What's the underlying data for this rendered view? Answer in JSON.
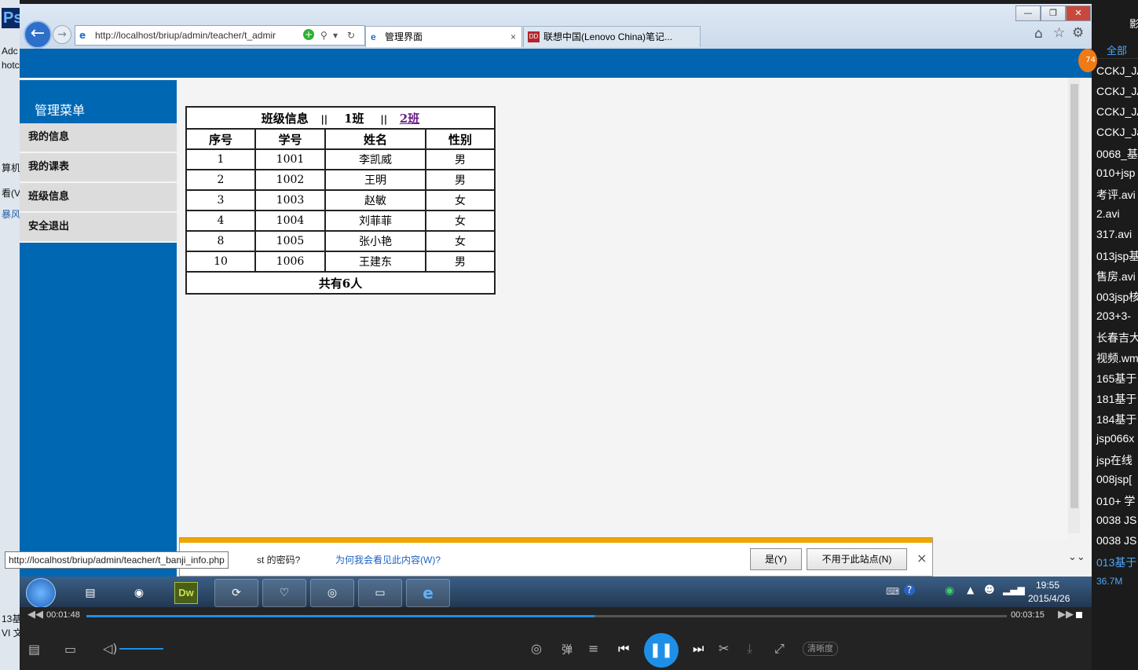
{
  "left_strip": {
    "app_badge": "Ps",
    "labels": [
      "Adc",
      "hotc",
      "算机",
      "看(V",
      "暴风",
      "13基",
      "VI 文"
    ]
  },
  "browser": {
    "address_url": "http://localhost/briup/admin/teacher/t_admir",
    "tabs": [
      {
        "label": "管理界面",
        "close": "×"
      },
      {
        "label": "联想中国(Lenovo China)笔记..."
      }
    ],
    "window_controls": [
      "—",
      "❐",
      "✕"
    ]
  },
  "sidebar": {
    "title": "管理菜单",
    "items": [
      "我的信息",
      "我的课表",
      "班级信息",
      "安全退出"
    ]
  },
  "class_table": {
    "title_prefix": "班级信息",
    "sep": "||",
    "class1": "1班",
    "class2": "2班",
    "headers": [
      "序号",
      "学号",
      "姓名",
      "性别"
    ],
    "rows": [
      [
        "1",
        "1001",
        "李凯威",
        "男"
      ],
      [
        "2",
        "1002",
        "王明",
        "男"
      ],
      [
        "3",
        "1003",
        "赵敏",
        "女"
      ],
      [
        "4",
        "1004",
        "刘菲菲",
        "女"
      ],
      [
        "8",
        "1005",
        "张小艳",
        "女"
      ],
      [
        "10",
        "1006",
        "王建东",
        "男"
      ]
    ],
    "total": "共有6人"
  },
  "infobar": {
    "text_visible": "st 的密码?",
    "why_link": "为何我会看见此内容(W)?",
    "yes_button": "是(Y)",
    "never_button": "不用于此站点(N)",
    "close": "×"
  },
  "status_url": "http://localhost/briup/admin/teacher/t_banji_info.php",
  "taskbar": {
    "clock_time": "19:55",
    "clock_date": "2015/4/26",
    "apps": [
      "start-orb",
      "text-editor",
      "eclipse",
      "Dw",
      "sync",
      "heart-app",
      "wifi-app",
      "explorer",
      "ie"
    ]
  },
  "playlist": {
    "tab": "全部",
    "items": [
      "CCKJ_JA",
      "CCKJ_JA",
      "CCKJ_JA",
      "CCKJ_Ja",
      "0068_基",
      "010+jsp",
      "考评.avi",
      "2.avi",
      "317.avi",
      "013jsp基",
      "售房.avi",
      "003jsp核",
      "203+3-",
      "长春吉大",
      "视频.wm",
      "165基于",
      "181基于",
      "184基于",
      "jsp066x",
      "jsp在线",
      "008jsp[",
      "010+ 学",
      "0038 JS",
      "0038 JS",
      "013基于"
    ],
    "active_index": 24,
    "size": "36.7M"
  },
  "player": {
    "current_time": "00:01:48",
    "total_time": "00:03:15",
    "progress": 0.552,
    "danmaku_label": "弹",
    "quality_label": "清晰度"
  }
}
